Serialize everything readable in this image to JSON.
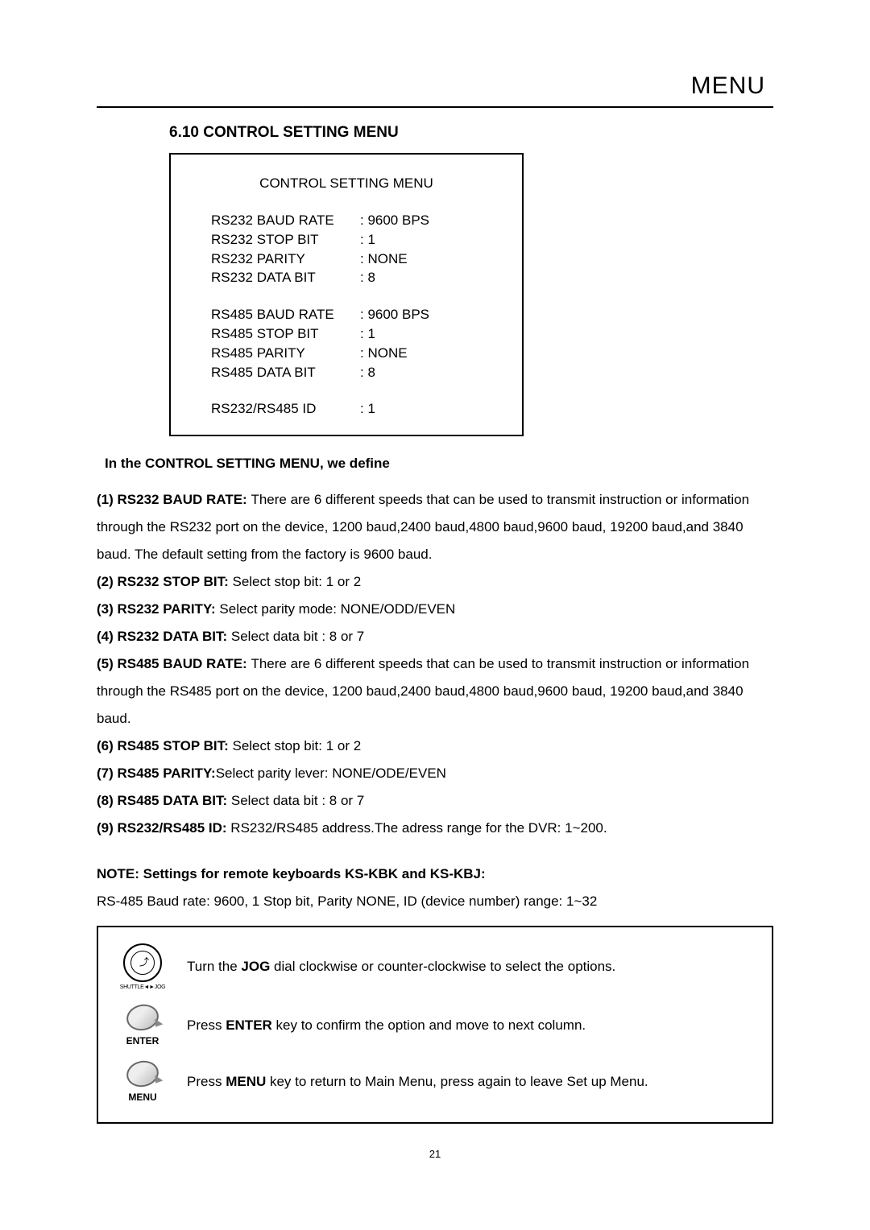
{
  "header": {
    "title": "MENU"
  },
  "section": {
    "heading": "6.10 CONTROL SETTING MENU"
  },
  "menu_box": {
    "title": "CONTROL SETTING MENU",
    "groups": [
      {
        "rows": [
          {
            "label": "RS232 BAUD RATE",
            "value": ": 9600 BPS"
          },
          {
            "label": "RS232 STOP BIT",
            "value": ": 1"
          },
          {
            "label": "RS232 PARITY",
            "value": ": NONE"
          },
          {
            "label": "RS232 DATA BIT",
            "value": ": 8"
          }
        ]
      },
      {
        "rows": [
          {
            "label": "RS485 BAUD RATE",
            "value": ": 9600 BPS"
          },
          {
            "label": "RS485 STOP BIT",
            "value": ": 1"
          },
          {
            "label": "RS485 PARITY",
            "value": ": NONE"
          },
          {
            "label": "RS485 DATA BIT",
            "value": ": 8"
          }
        ]
      },
      {
        "rows": [
          {
            "label": "RS232/RS485 ID",
            "value": ": 1"
          }
        ]
      }
    ]
  },
  "intro": " In the CONTROL SETTING MENU, we define",
  "items": {
    "i1_bold": "(1) RS232 BAUD RATE:  ",
    "i1_text": "There are 6 different speeds that can be used to transmit instruction or information through the RS232 port on the device, 1200 baud,2400 baud,4800 baud,9600 baud, 19200 baud,and 3840 baud. The default setting from the factory is 9600 baud.",
    "i2_bold": "(2) RS232 STOP BIT: ",
    "i2_text": "Select stop bit: 1 or 2",
    "i3_bold": "(3) RS232 PARITY: ",
    "i3_text": "Select parity mode: NONE/ODD/EVEN",
    "i4_bold": "(4) RS232 DATA BIT: ",
    "i4_text": "Select data bit : 8 or 7",
    "i5_bold": "(5) RS485 BAUD RATE: ",
    "i5_text": "There are 6 different speeds that can be used to transmit instruction or  information through the RS485 port on the device, 1200 baud,2400 baud,4800 baud,9600 baud,  19200 baud,and 3840 baud.",
    "i6_bold": "(6) RS485 STOP BIT: ",
    "i6_text": "Select stop bit: 1 or 2",
    "i7_bold": "(7) RS485 PARITY:",
    "i7_text": "Select parity lever: NONE/ODE/EVEN",
    "i8_bold": "(8) RS485 DATA BIT: ",
    "i8_text": "Select data bit : 8 or 7",
    "i9_bold": "(9) RS232/RS485 ID: ",
    "i9_text": "RS232/RS485 address.The adress range  for the DVR: 1~200."
  },
  "note": {
    "title": "NOTE: Settings for remote keyboards KS-KBK and KS-KBJ:",
    "text": "RS-485 Baud rate: 9600, 1 Stop bit, Parity NONE, ID (device number) range: 1~32"
  },
  "instructions": {
    "jog_label": "SHUTTLE◄►JOG",
    "jog_prefix": "Turn the ",
    "jog_bold": "JOG",
    "jog_suffix": " dial clockwise or counter-clockwise to select the options.",
    "enter_label": "ENTER",
    "enter_prefix": "Press ",
    "enter_bold": "ENTER",
    "enter_suffix": " key to confirm the option and move to next column.",
    "menu_label": "MENU",
    "menu_prefix": "Press ",
    "menu_bold": "MENU",
    "menu_suffix": " key to return to Main Menu, press again to leave Set up Menu."
  },
  "page_number": "21"
}
